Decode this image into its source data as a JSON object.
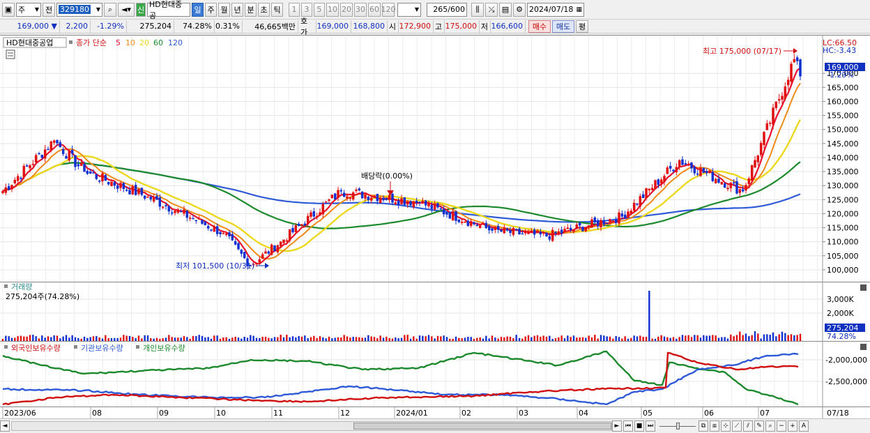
{
  "toolbar": {
    "market": "주",
    "prev": "전",
    "code": "329180",
    "new_badge": "신",
    "stock_name": "HD현대중공",
    "periods": [
      "일",
      "주",
      "월",
      "년",
      "분",
      "초",
      "틱"
    ],
    "active_period": "일",
    "intervals": [
      "1",
      "3",
      "5",
      "10",
      "20",
      "30",
      "60",
      "120"
    ],
    "count": "265",
    "count_total": "/600",
    "date": "2024/07/18"
  },
  "quote": {
    "price": "169,000",
    "arrow": "▼",
    "change": "2,200",
    "change_pct": "-1.29%",
    "volume": "275,204",
    "volume_ratio": "74.28%",
    "turnover": "0.31%",
    "amount": "46,665백만",
    "ask_label": "호가",
    "ask": "169,000",
    "bid": "168,800",
    "open_label": "시",
    "open": "172,900",
    "high_label": "고",
    "high": "175,000",
    "low_label": "저",
    "low": "166,600",
    "buy": "매수",
    "sell": "매도",
    "eval": "평"
  },
  "price_panel": {
    "name_tag": "HD현대중공업",
    "legend_title": "종가 단순",
    "ma": [
      {
        "period": "5",
        "color": "#e8102a"
      },
      {
        "period": "10",
        "color": "#ef8a18"
      },
      {
        "period": "20",
        "color": "#ecd81c"
      },
      {
        "period": "60",
        "color": "#1c8a2c"
      },
      {
        "period": "120",
        "color": "#2e5ad8"
      }
    ],
    "lc": "LC:66.50",
    "hc": "HC:-3.43",
    "high_note": "최고 175,000 (07/17)",
    "low_note": "최저 101,500 (10/31)",
    "dividend_note": "배당락(0.00%)",
    "last_tag": "169,000",
    "last_pct": "-1.29%",
    "y_ticks": [
      "170,000",
      "165,000",
      "160,000",
      "155,000",
      "150,000",
      "145,000",
      "140,000",
      "135,000",
      "130,000",
      "125,000",
      "120,000",
      "115,000",
      "110,000",
      "105,000",
      "100,000"
    ]
  },
  "volume_panel": {
    "title": "거래량",
    "value": "275,204주(74.28%)",
    "y_ticks": [
      "3,000K",
      "2,000K"
    ],
    "last_tag": "275,204",
    "last_pct": "74.28%"
  },
  "holding_panel": {
    "legend": [
      {
        "label": "외국인보유수량",
        "color": "#d01010"
      },
      {
        "label": "기관보유수량",
        "color": "#2e5ad8"
      },
      {
        "label": "개인보유수량",
        "color": "#1c8a2c"
      }
    ],
    "y_ticks": [
      "-2,000,000",
      "-2,500,000"
    ]
  },
  "x_axis": {
    "labels": [
      "2023/06",
      "08",
      "09",
      "10",
      "11",
      "12",
      "2024/01",
      "02",
      "03",
      "04",
      "05",
      "06",
      "07"
    ],
    "end_label": "07/18"
  },
  "chart_data": {
    "type": "candlestick",
    "title": "HD현대중공업",
    "ylim": [
      97500,
      178000
    ],
    "close_series_approx": [
      {
        "x": "2023/06",
        "y": 128000
      },
      {
        "x": "2023/07",
        "y": 146000
      },
      {
        "x": "2023/08",
        "y": 135000
      },
      {
        "x": "2023/09",
        "y": 126000
      },
      {
        "x": "2023/10",
        "y": 113000
      },
      {
        "x": "2023/10/31",
        "y": 101500
      },
      {
        "x": "2023/11",
        "y": 110000
      },
      {
        "x": "2023/12",
        "y": 128000
      },
      {
        "x": "2024/01",
        "y": 124000
      },
      {
        "x": "2024/02",
        "y": 114000
      },
      {
        "x": "2024/03",
        "y": 112000
      },
      {
        "x": "2024/04",
        "y": 119000
      },
      {
        "x": "2024/05",
        "y": 139000
      },
      {
        "x": "2024/06",
        "y": 128000
      },
      {
        "x": "2024/07/17",
        "y": 175000
      },
      {
        "x": "2024/07/18",
        "y": 169000
      }
    ]
  }
}
